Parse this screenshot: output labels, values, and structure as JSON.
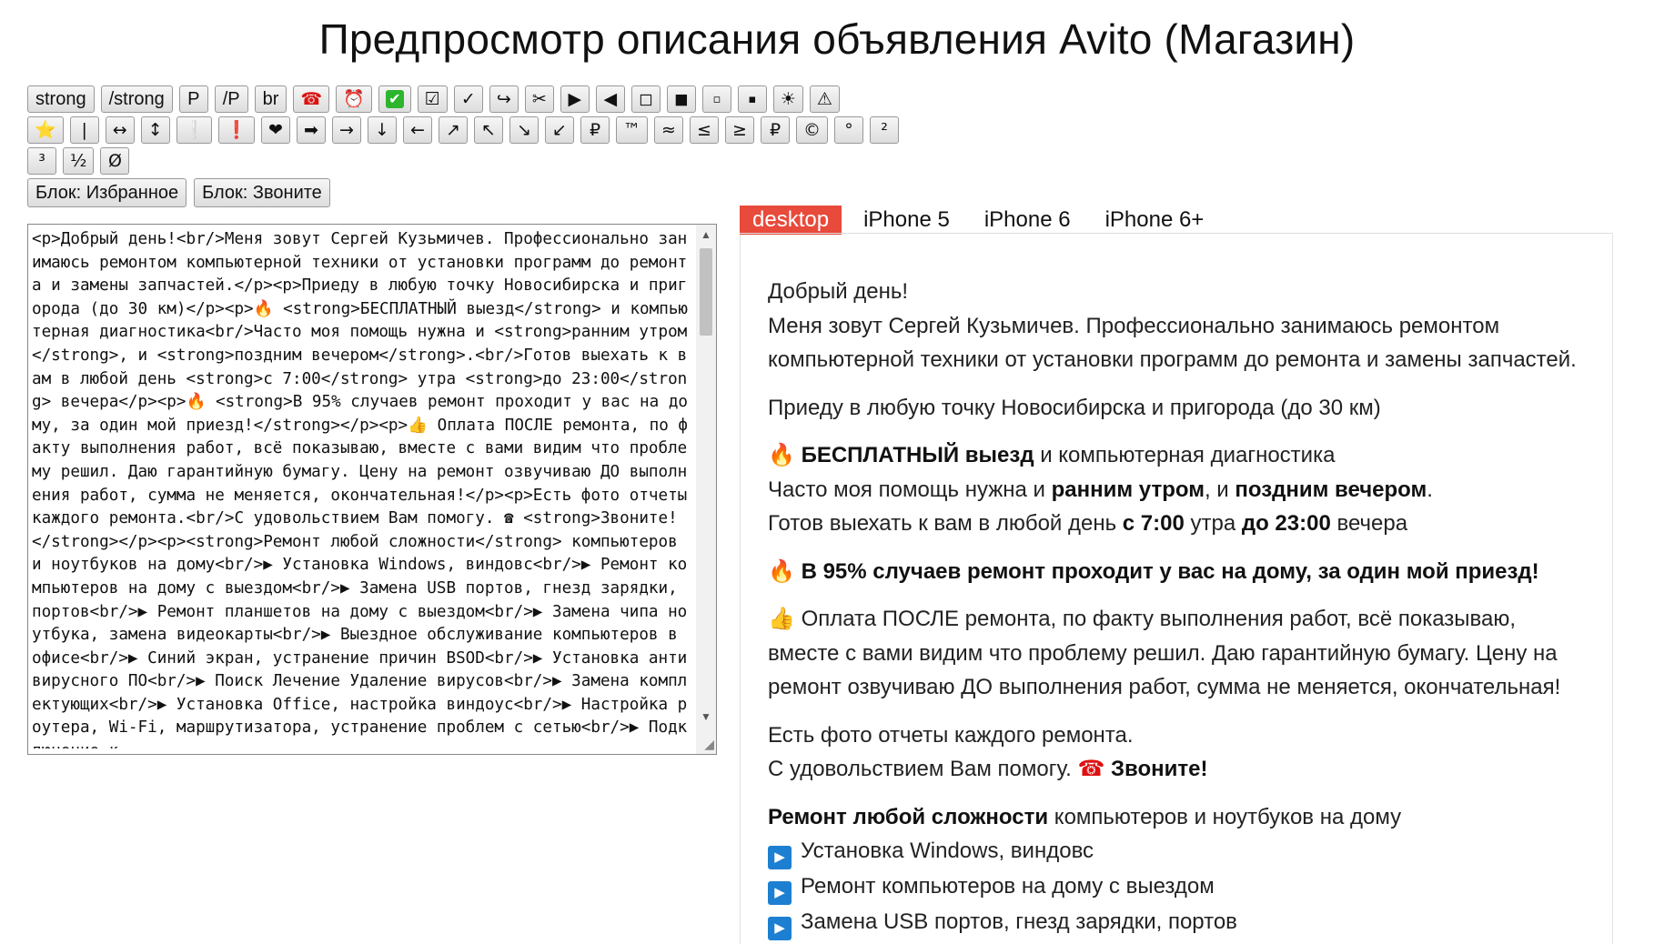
{
  "title": "Предпросмотр описания объявления Avito (Магазин)",
  "toolbar": {
    "row1": [
      {
        "label": "strong",
        "name": "strong-button"
      },
      {
        "label": "/strong",
        "name": "close-strong-button"
      },
      {
        "label": "P",
        "name": "p-button"
      },
      {
        "label": "/P",
        "name": "close-p-button"
      },
      {
        "label": "br",
        "name": "br-button"
      },
      {
        "label": "☎",
        "name": "phone-icon-button"
      },
      {
        "label": "⏰",
        "name": "alarm-icon-button"
      },
      {
        "label": "✔",
        "name": "green-check-icon-button"
      },
      {
        "label": "☑",
        "name": "checkbox-icon-button"
      },
      {
        "label": "✓",
        "name": "checkmark-icon-button"
      },
      {
        "label": "↪",
        "name": "arrow-hook-icon-button"
      },
      {
        "label": "✂",
        "name": "scissors-icon-button"
      },
      {
        "label": "▶",
        "name": "play-right-icon-button"
      },
      {
        "label": "◀",
        "name": "play-left-icon-button"
      },
      {
        "label": "◻",
        "name": "white-square-icon-button"
      },
      {
        "label": "◼",
        "name": "black-square-icon-button"
      },
      {
        "label": "▫",
        "name": "small-white-square-icon-button"
      },
      {
        "label": "▪",
        "name": "small-black-square-icon-button"
      },
      {
        "label": "☀",
        "name": "sun-icon-button"
      },
      {
        "label": "⚠",
        "name": "warning-icon-button"
      }
    ],
    "row2": [
      {
        "label": "⭐",
        "name": "star-icon-button"
      },
      {
        "label": "|",
        "name": "pipe-button"
      },
      {
        "label": "↔",
        "name": "left-right-arrow-button"
      },
      {
        "label": "↕",
        "name": "up-down-arrow-button"
      },
      {
        "label": "❕",
        "name": "white-exclamation-button"
      },
      {
        "label": "❗",
        "name": "red-exclamation-button"
      },
      {
        "label": "❤",
        "name": "heart-icon-button"
      },
      {
        "label": "➡",
        "name": "bold-right-arrow-button"
      },
      {
        "label": "→",
        "name": "right-arrow-button"
      },
      {
        "label": "↓",
        "name": "down-arrow-button"
      },
      {
        "label": "←",
        "name": "left-arrow-button"
      },
      {
        "label": "↗",
        "name": "up-right-arrow-button"
      },
      {
        "label": "↖",
        "name": "up-left-arrow-button"
      },
      {
        "label": "↘",
        "name": "down-right-arrow-button"
      },
      {
        "label": "↙",
        "name": "down-left-arrow-button"
      },
      {
        "label": "₽",
        "name": "ruble-button"
      },
      {
        "label": "™",
        "name": "trademark-button"
      },
      {
        "label": "≈",
        "name": "approx-button"
      },
      {
        "label": "≤",
        "name": "less-equal-button"
      },
      {
        "label": "≥",
        "name": "greater-equal-button"
      },
      {
        "label": "₽",
        "name": "ruble-button-2"
      },
      {
        "label": "©",
        "name": "copyright-button"
      },
      {
        "label": "°",
        "name": "degree-button"
      },
      {
        "label": "²",
        "name": "superscript-two-button"
      }
    ],
    "row3": [
      {
        "label": "³",
        "name": "superscript-three-button"
      },
      {
        "label": "½",
        "name": "half-button"
      },
      {
        "label": "Ø",
        "name": "diameter-button"
      }
    ],
    "blocks": [
      {
        "label": "Блок: Избранное",
        "name": "block-favorites-button"
      },
      {
        "label": "Блок: Звоните",
        "name": "block-call-button"
      }
    ]
  },
  "editor": {
    "text": "<p>Добрый день!<br/>Меня зовут Сергей Кузьмичев. Профессионально занимаюсь ремонтом компьютерной техники от установки программ до ремонта и замены запчастей.</p><p>Приеду в любую точку Новосибирска и пригорода (до 30 км)</p><p>🔥 <strong>БЕСПЛАТНЫЙ выезд</strong> и компьютерная диагностика<br/>Часто моя помощь нужна и <strong>ранним утром</strong>, и <strong>поздним вечером</strong>.<br/>Готов выехать к вам в любой день <strong>с 7:00</strong> утра <strong>до 23:00</strong> вечера</p><p>🔥 <strong>В 95% случаев ремонт проходит у вас на дому, за один мой приезд!</strong></p><p>👍 Оплата ПОСЛЕ ремонта, по факту выполнения работ, всё показываю, вместе с вами видим что проблему решил. Даю гарантийную бумагу. Цену на ремонт озвучиваю ДО выполнения работ, сумма не меняется, окончательная!</p><p>Есть фото отчеты каждого ремонта.<br/>С удовольствием Вам помогу. ☎ <strong>Звоните!</strong></p><p><strong>Ремонт любой сложности</strong> компьютеров и ноутбуков на дому<br/>▶ Установка Windows, виндовс<br/>▶ Ремонт компьютеров на дому с выездом<br/>▶ Замена USB портов, гнезд зарядки, портов<br/>▶ Ремонт планшетов на дому с выездом<br/>▶ Замена чипа ноутбука, замена видеокарты<br/>▶ Выездное обслуживание компьютеров в офисе<br/>▶ Синий экран, устранение причин BSOD<br/>▶ Установка антивирусного ПО<br/>▶ Поиск Лечение Удаление вирусов<br/>▶ Замена комплектующих<br/>▶ Установка Office, настройка виндоус<br/>▶ Настройка роутера, Wi-Fi, маршрутизатора, устранение проблем с сетью<br/>▶ Подключение к"
  },
  "tabs": [
    {
      "label": "desktop",
      "name": "tab-desktop",
      "active": true
    },
    {
      "label": "iPhone 5",
      "name": "tab-iphone-5",
      "active": false
    },
    {
      "label": "iPhone 6",
      "name": "tab-iphone-6",
      "active": false
    },
    {
      "label": "iPhone 6+",
      "name": "tab-iphone-6-plus",
      "active": false
    }
  ],
  "preview": {
    "p1_line1": "Добрый день!",
    "p1_line2": "Меня зовут Сергей Кузьмичев. Профессионально занимаюсь ремонтом компьютерной техники от установки программ до ремонта и замены запчастей.",
    "p2": "Приеду в любую точку Новосибирска и пригорода (до 30 км)",
    "p3_strong1": "БЕСПЛАТНЫЙ выезд",
    "p3_text1": " и компьютерная диагностика",
    "p3_text2": "Часто моя помощь нужна и ",
    "p3_strong2": "ранним утром",
    "p3_text3": ", и ",
    "p3_strong3": "поздним вечером",
    "p3_text4": ".",
    "p3_text5": "Готов выехать к вам в любой день ",
    "p3_strong4": "с 7:00",
    "p3_text6": " утра ",
    "p3_strong5": "до 23:00",
    "p3_text7": " вечера",
    "p4_strong": "В 95% случаев ремонт проходит у вас на дому, за один мой приезд!",
    "p5": "Оплата ПОСЛЕ ремонта, по факту выполнения работ, всё показываю, вместе с вами видим что проблему решил. Даю гарантийную бумагу. Цену на ремонт озвучиваю ДО выполнения работ, сумма не меняется, окончательная!",
    "p6_line1": "Есть фото отчеты каждого ремонта.",
    "p6_text": "С удовольствием Вам помогу. ",
    "p6_strong": "Звоните!",
    "p7_strong": "Ремонт любой сложности",
    "p7_text": " компьютеров и ноутбуков на дому",
    "list": [
      "Установка Windows, виндовс",
      "Ремонт компьютеров на дому с выездом",
      "Замена USB портов, гнезд зарядки, портов"
    ]
  }
}
